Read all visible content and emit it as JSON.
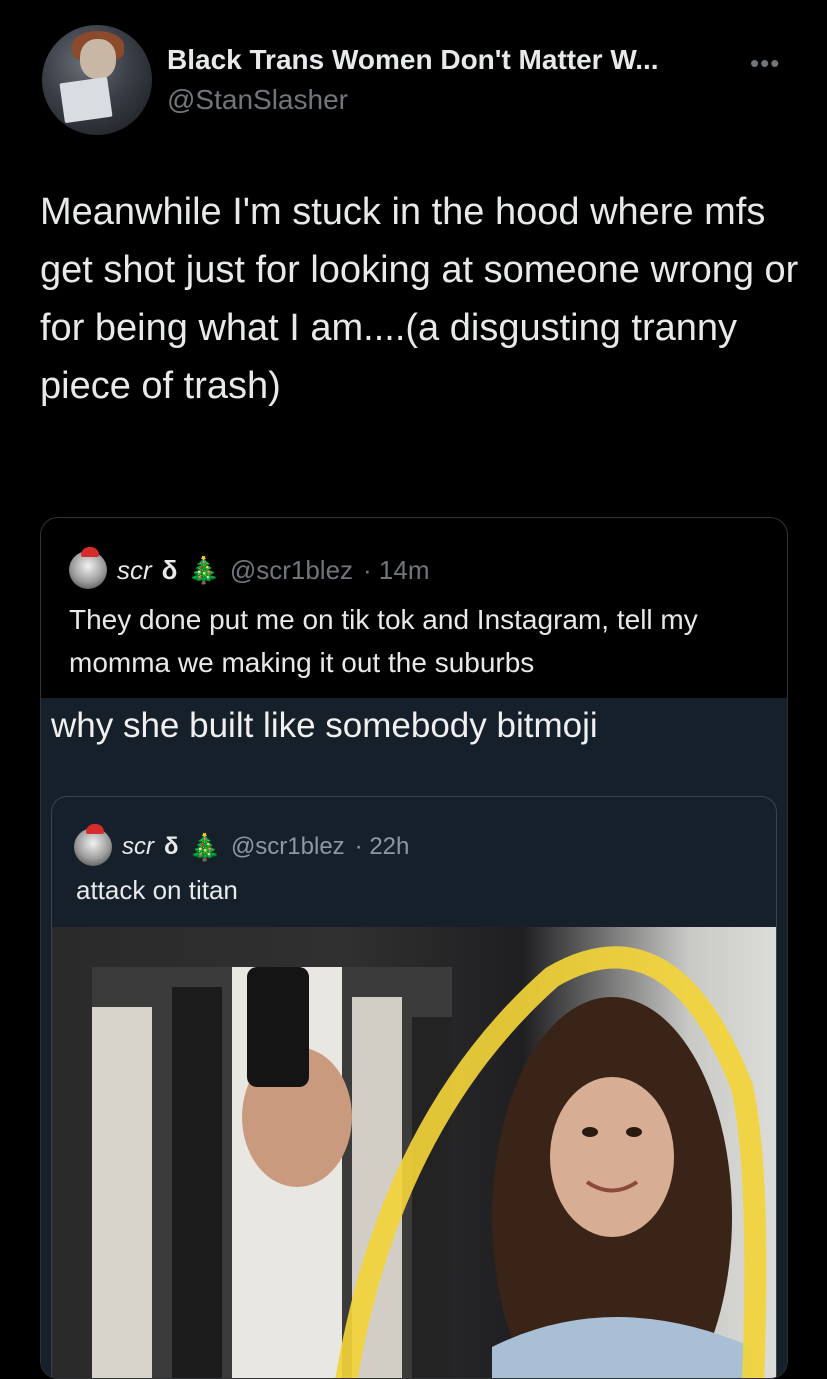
{
  "tweet": {
    "display_name": "Black Trans Women Don't Matter W...",
    "handle": "@StanSlasher",
    "more_icon": "•••",
    "text": "Meanwhile I'm stuck in the hood where mfs get shot just for looking at someone wrong or for being what I am....(a disgusting tranny piece of trash)"
  },
  "quote": {
    "name": "scr",
    "glyph": "δ",
    "tree_icon": "🎄",
    "handle": "@scr1blez",
    "time": "· 14m",
    "text": "They done put me on tik tok and Instagram, tell my momma we making it out the suburbs"
  },
  "media": {
    "caption": "why she built like somebody bitmoji",
    "inner": {
      "name": "scr",
      "glyph": "δ",
      "tree_icon": "🎄",
      "handle": "@scr1blez",
      "time": "· 22h",
      "text": "attack on titan"
    }
  },
  "colors": {
    "background": "#000000",
    "text": "#e7e9ea",
    "secondary": "#71767b",
    "dim_background": "#15202b",
    "highlight_arc": "#f2d43a"
  }
}
